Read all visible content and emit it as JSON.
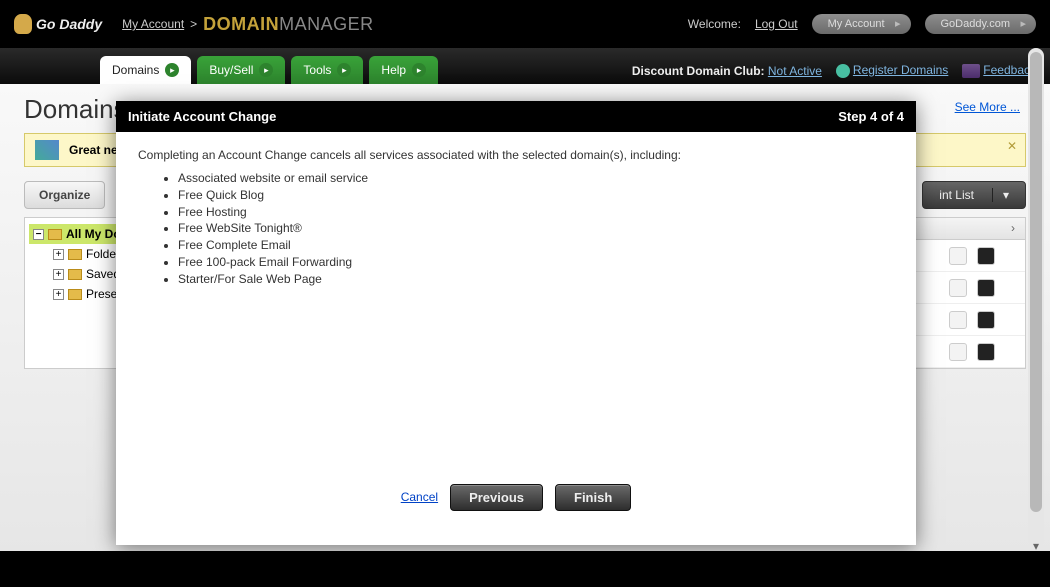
{
  "header": {
    "logo_text": "Go Daddy",
    "breadcrumb_account": "My Account",
    "breadcrumb_sep": ">",
    "brand_a": "DOMAIN",
    "brand_b": "MANAGER",
    "welcome": "Welcome:",
    "logout": "Log Out",
    "pill_account": "My Account",
    "pill_godaddy": "GoDaddy.com"
  },
  "nav": {
    "tabs": [
      {
        "label": "Domains"
      },
      {
        "label": "Buy/Sell"
      },
      {
        "label": "Tools"
      },
      {
        "label": "Help"
      }
    ],
    "club_label": "Discount Domain Club:",
    "club_status": "Not Active",
    "register": "Register Domains",
    "feedback": "Feedback"
  },
  "page": {
    "title": "Domains",
    "see_more": "See More ...",
    "notice": "Great ne",
    "organize": "Organize",
    "print_list": "int List"
  },
  "tree": {
    "root": "All My Do",
    "nodes": [
      "Folders",
      "Saved S",
      "Preset "
    ]
  },
  "modal": {
    "title": "Initiate Account Change",
    "step": "Step 4 of 4",
    "message": "Completing an Account Change cancels all services associated with the selected domain(s), including:",
    "bullets": [
      "Associated website or email service",
      "Free Quick Blog",
      "Free Hosting",
      "Free WebSite Tonight®",
      "Free Complete Email",
      "Free 100-pack Email Forwarding",
      "Starter/For Sale Web Page"
    ],
    "cancel": "Cancel",
    "previous": "Previous",
    "finish": "Finish"
  }
}
